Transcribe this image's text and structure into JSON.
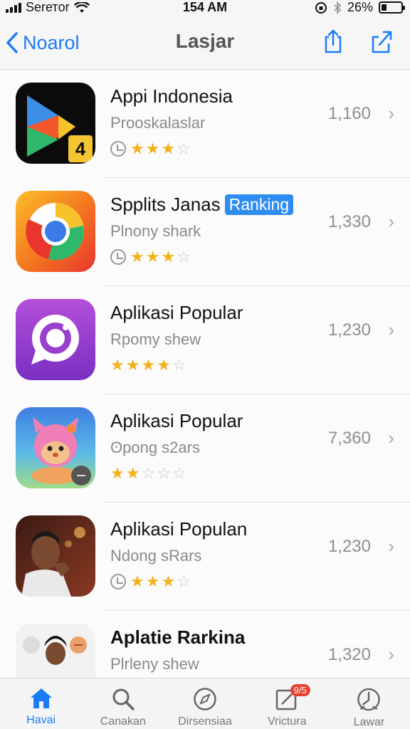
{
  "status_bar": {
    "carrier": "Serетor",
    "time": "154 AM",
    "battery": "26%",
    "battery_level": 0.26
  },
  "navbar": {
    "back_label": "Noarol",
    "title": "Lasjar"
  },
  "apps": [
    {
      "name": "Appi Indonesia",
      "badge": "",
      "subtitle": "Prooskalaslar",
      "stars": 3,
      "count": "1,160",
      "clock": true
    },
    {
      "name": "Spplits Janas",
      "badge": "Ranking",
      "subtitle": "Plnony shark",
      "stars": 3,
      "count": "1,330",
      "clock": true
    },
    {
      "name": "Aplikasi Popular",
      "badge": "",
      "subtitle": "Rpomy shew",
      "stars": 4,
      "count": "1,230",
      "clock": false
    },
    {
      "name": "Aplikasi Popular",
      "badge": "",
      "subtitle": "ʘpong s2ars",
      "stars": 2,
      "count": "7,360",
      "clock": false
    },
    {
      "name": "Aplikasi Populan",
      "badge": "",
      "subtitle": "Ndong sRars",
      "stars": 3,
      "count": "1,230",
      "clock": true
    },
    {
      "name": "Aplatie Rarkina",
      "badge": "",
      "subtitle": "Plrleny shew",
      "stars": 0,
      "count": "1,320",
      "clock": false
    }
  ],
  "tabs": [
    {
      "label": "Havai",
      "icon": "home-icon",
      "active": true
    },
    {
      "label": "Canakan",
      "icon": "search-icon",
      "active": false
    },
    {
      "label": "Dirsensiaa",
      "icon": "compass-icon",
      "active": false
    },
    {
      "label": "Vrictura",
      "icon": "edit-icon",
      "active": false,
      "badge": "9/5"
    },
    {
      "label": "Lawar",
      "icon": "clock-icon",
      "active": false
    }
  ],
  "colors": {
    "accent": "#1a7cf5",
    "star": "#f2b21b",
    "badge_red": "#e8412f"
  }
}
